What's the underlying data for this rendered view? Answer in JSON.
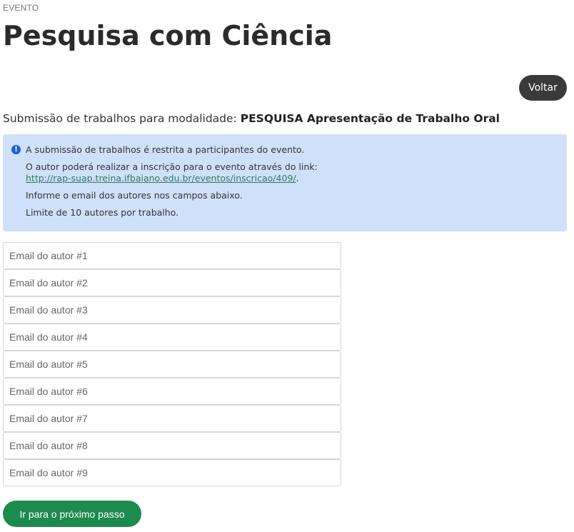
{
  "header": {
    "eyebrow": "EVENTO",
    "title": "Pesquisa com Ciência"
  },
  "actions": {
    "back_label": "Voltar",
    "next_label": "Ir para o próximo passo"
  },
  "submission": {
    "prefix": "Submissão de trabalhos para modalidade: ",
    "modality": "PESQUISA Apresentação de Trabalho Oral"
  },
  "info": {
    "icon": "info-circle-icon",
    "line1": "A submissão de trabalhos é restrita a participantes do evento.",
    "line2_prefix": "O autor poderá realizar a inscrição para o evento através do link: ",
    "line2_link": "http://rap-suap.treina.ifbaiano.edu.br/eventos/inscricao/409/",
    "line2_suffix": ".",
    "line3": "Informe o email dos autores nos campos abaixo.",
    "line4": "Limite de 10 autores por trabalho."
  },
  "author_fields": [
    {
      "placeholder": "Email do autor #1",
      "value": ""
    },
    {
      "placeholder": "Email do autor #2",
      "value": ""
    },
    {
      "placeholder": "Email do autor #3",
      "value": ""
    },
    {
      "placeholder": "Email do autor #4",
      "value": ""
    },
    {
      "placeholder": "Email do autor #5",
      "value": ""
    },
    {
      "placeholder": "Email do autor #6",
      "value": ""
    },
    {
      "placeholder": "Email do autor #7",
      "value": ""
    },
    {
      "placeholder": "Email do autor #8",
      "value": ""
    },
    {
      "placeholder": "Email do autor #9",
      "value": ""
    }
  ],
  "colors": {
    "info_bg": "#cfe0fb",
    "info_icon": "#1766d8",
    "back_button": "#3a3a3a",
    "next_button": "#1d8a4e",
    "link": "#2e7d5a"
  }
}
